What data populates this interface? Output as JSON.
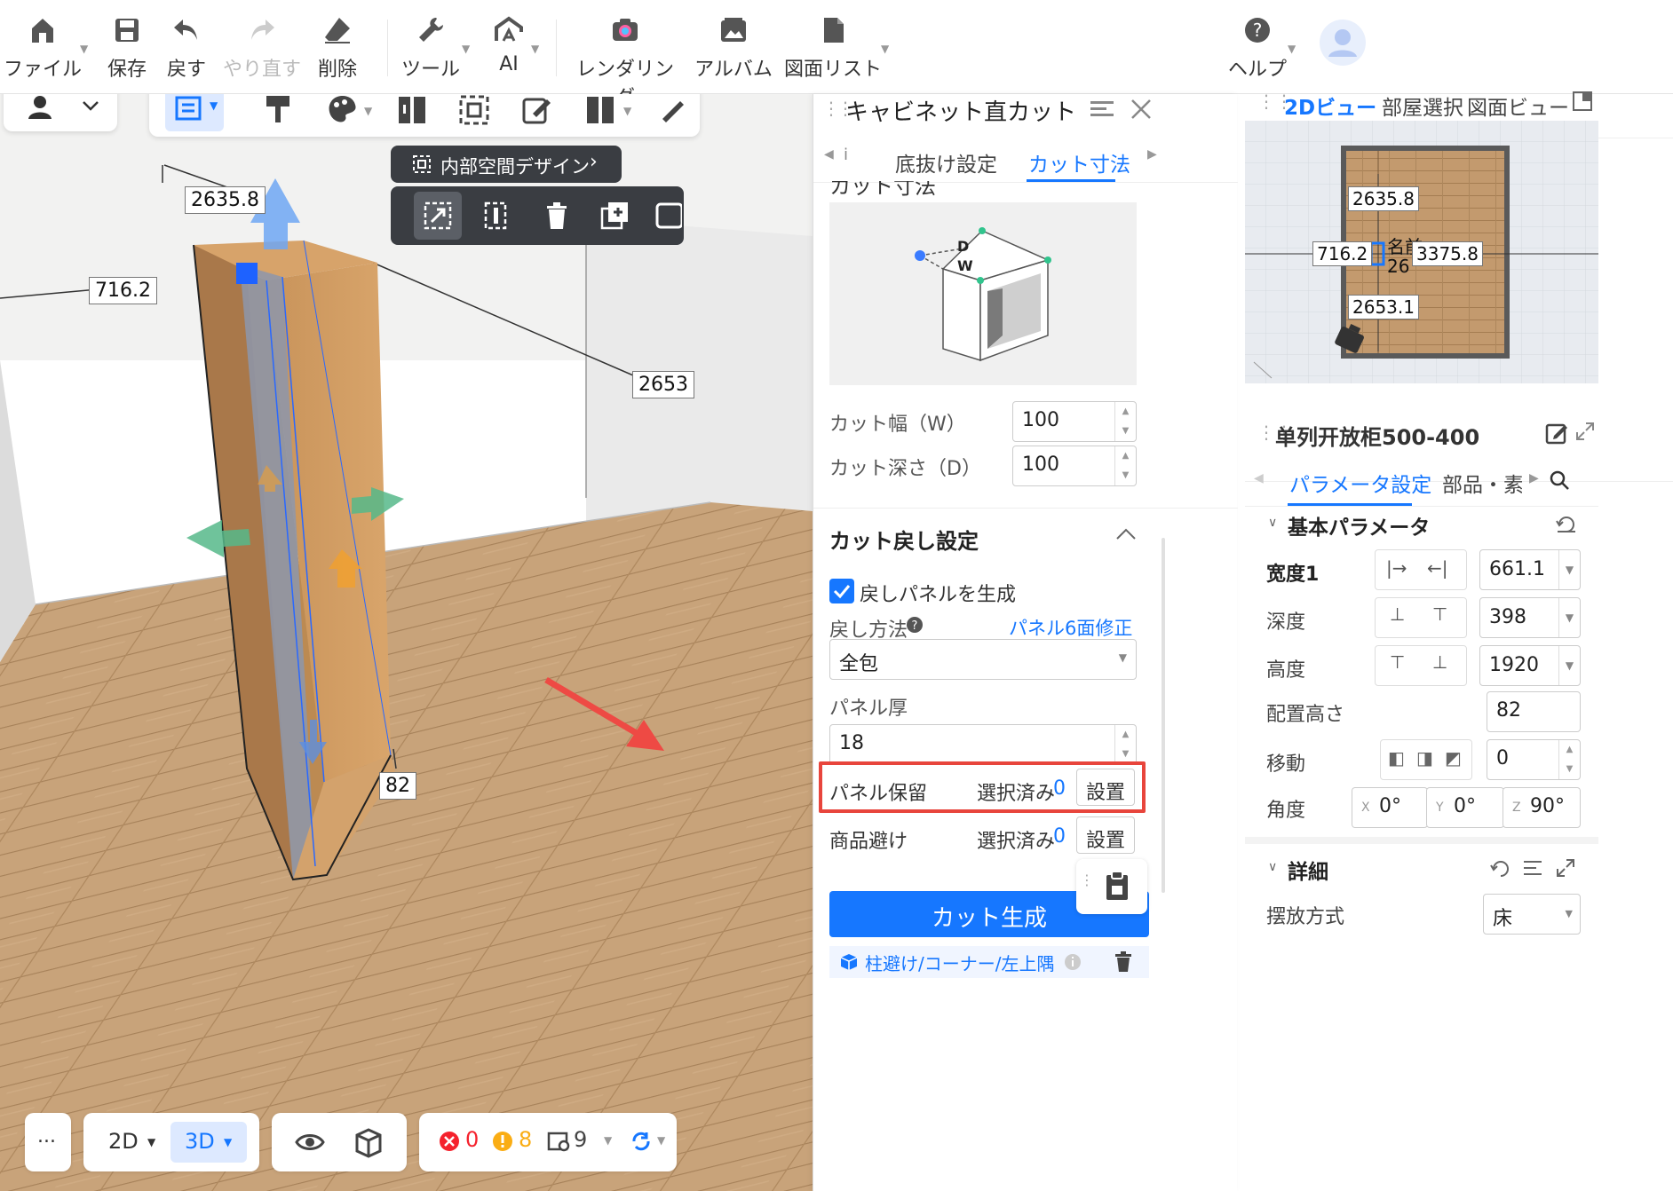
{
  "menu": {
    "file": "ファイル",
    "save": "保存",
    "undo": "戻す",
    "redo": "やり直す",
    "delete": "削除",
    "tools": "ツール",
    "ai": "AI",
    "render": "レンダリング",
    "album": "アルバム",
    "drawing_list": "図面リスト",
    "help": "ヘルプ"
  },
  "viewport": {
    "interior_design_button": "内部空間デザイン",
    "dims": {
      "top": "2635.8",
      "left": "716.2",
      "right": "2653",
      "bottom": "82"
    }
  },
  "bottom": {
    "more": "...",
    "view_2d": "2D",
    "view_3d": "3D",
    "errors": "0",
    "warnings": "8",
    "items": "9"
  },
  "cut_panel": {
    "title": "キャビネット直カット",
    "tabs": [
      "底抜け設定",
      "カット寸法"
    ],
    "section_clipped": "カット寸法",
    "diagram_labels": {
      "d": "D",
      "w": "W"
    },
    "cut_width_label": "カット幅（W）",
    "cut_width_value": "100",
    "cut_depth_label": "カット深さ（D）",
    "cut_depth_value": "100",
    "return_section": "カット戻し設定",
    "generate_panel_label": "戻しパネルを生成",
    "return_method_label": "戻し方法",
    "panel_fix_link": "パネル6面修正",
    "return_method_value": "全包",
    "panel_thickness_label": "パネル厚",
    "panel_thickness_value": "18",
    "panel_keep_label": "パネル保留",
    "selected_text": "選択済み",
    "panel_keep_count": "0",
    "setting_button": "設置",
    "avoid_label": "商品避け",
    "avoid_count": "0",
    "generate_button": "カット生成",
    "footer_link": "柱避け/コーナー/左上隅"
  },
  "view2d": {
    "tabs": [
      "2Dビュー",
      "部屋選択",
      "図面ビュー"
    ],
    "dims": {
      "top": "2635.8",
      "left": "716.2",
      "right": "3375.8",
      "bottom": "2653.1",
      "name_partial": "名前",
      "num_partial": "26"
    }
  },
  "props": {
    "title": "单列开放柜500-400",
    "tabs": [
      "パラメータ設定",
      "部品・素材"
    ],
    "basic_section": "基本パラメータ",
    "width_label": "宽度1",
    "width_value": "661.1",
    "depth_label": "深度",
    "depth_value": "398",
    "height_label": "高度",
    "height_value": "1920",
    "place_height_label": "配置高さ",
    "place_height_value": "82",
    "move_label": "移動",
    "move_value": "0",
    "angle_label": "角度",
    "angle_x_label": "X",
    "angle_x": "0°",
    "angle_y_label": "Y",
    "angle_y": "0°",
    "angle_z_label": "Z",
    "angle_z": "90°",
    "detail_section": "詳細",
    "placement_label": "摆放方式",
    "placement_value": "床"
  },
  "colors": {
    "accent": "#1677ff",
    "highlight_border": "#e8453c",
    "arrow": "#ee4a44",
    "error": "#f5222d",
    "warning": "#faad14"
  }
}
